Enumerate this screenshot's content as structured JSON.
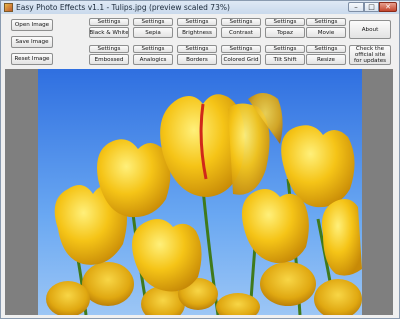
{
  "window": {
    "title": "Easy Photo Effects v1.1 - Tulips.jpg (preview scaled 73%)"
  },
  "window_controls": {
    "minimize": "–",
    "maximize": "□",
    "close": "✕"
  },
  "file_buttons": {
    "open": "Open Image",
    "save": "Save Image",
    "reset": "Reset Image"
  },
  "effects": [
    {
      "settings": "Settings",
      "label": "Black & White"
    },
    {
      "settings": "Settings",
      "label": "Sepia"
    },
    {
      "settings": "Settings",
      "label": "Brightness"
    },
    {
      "settings": "Settings",
      "label": "Contrast"
    },
    {
      "settings": "Settings",
      "label": "Topaz"
    },
    {
      "settings": "Settings",
      "label": "Movie"
    },
    {
      "settings": "Settings",
      "label": "Embossed"
    },
    {
      "settings": "Settings",
      "label": "Analogics"
    },
    {
      "settings": "Settings",
      "label": "Borders"
    },
    {
      "settings": "Settings",
      "label": "Colored Grid"
    },
    {
      "settings": "Settings",
      "label": "Tilt Shift"
    },
    {
      "settings": "Settings",
      "label": "Resize"
    }
  ],
  "about": "About",
  "check_updates": "Check the official site for updates",
  "preview": {
    "subject": "yellow tulips against blue sky"
  }
}
